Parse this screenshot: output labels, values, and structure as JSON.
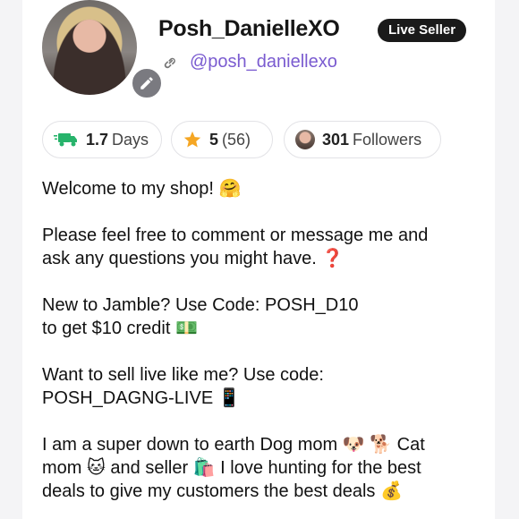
{
  "profile": {
    "username": "Posh_DanielleXO",
    "badge": "Live Seller",
    "handle": "@posh_daniellexo"
  },
  "stats": {
    "shipping": {
      "value": "1.7",
      "unit": "Days"
    },
    "rating": {
      "value": "5",
      "count": "(56)"
    },
    "followers": {
      "value": "301",
      "label": "Followers"
    }
  },
  "bio": {
    "l1": "Welcome to my shop! 🤗",
    "l2": "Please feel free to comment or message me and",
    "l3": "ask any questions you might have.  ❓",
    "l4": "New to Jamble? Use Code: POSH_D10",
    "l5": "to get $10 credit 💵",
    "l6": "Want to sell live like me? Use code:",
    "l7": "POSH_DAGNG-LIVE 📱",
    "l8": "I am a super down to earth Dog mom 🐶 🐕 Cat",
    "l9": "mom 🐱  and seller 🛍️  I love hunting for the best",
    "l10": "deals to give my customers the best deals 💰"
  },
  "colors": {
    "accent": "#7a5bd0",
    "badge_bg": "#1a1a1a",
    "truck": "#27b36b",
    "star": "#f5a623"
  },
  "icons": {
    "edit": "pencil-icon",
    "link": "link-icon",
    "shipping": "truck-icon",
    "rating": "star-icon"
  }
}
